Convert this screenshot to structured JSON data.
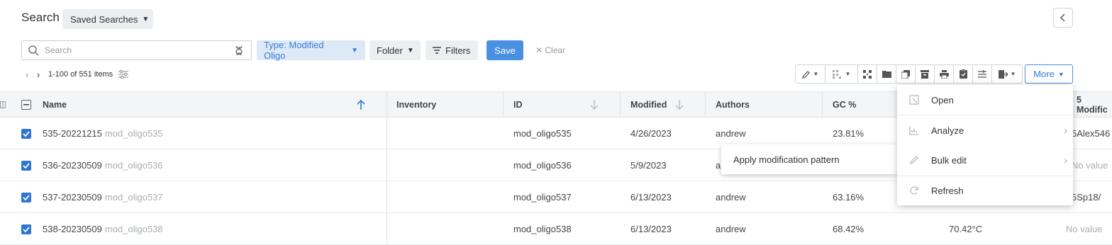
{
  "header": {
    "title": "Search",
    "saved_searches": "Saved Searches"
  },
  "search": {
    "placeholder": "Search",
    "value": ""
  },
  "filters": {
    "type_chip": "Type: Modified Oligo",
    "folder_chip": "Folder",
    "filters_chip": "Filters",
    "save": "Save",
    "clear": "Clear"
  },
  "pager": {
    "count": "1-100 of 551 items"
  },
  "toolbar": {
    "more": "More"
  },
  "table": {
    "columns": [
      "Name",
      "Inventory",
      "ID",
      "Modified",
      "Authors",
      "GC %",
      "5 Modific"
    ],
    "rows": [
      {
        "name": "535-20221215",
        "sub": "mod_oligo535",
        "id": "mod_oligo535",
        "modified": "4/26/2023",
        "author": "andrew",
        "gc": "23.81%",
        "tm": "",
        "mod5": "5Alex546"
      },
      {
        "name": "536-20230509",
        "sub": "mod_oligo536",
        "id": "mod_oligo536",
        "modified": "5/9/2023",
        "author": "a",
        "gc": "",
        "tm": "",
        "mod5": "No value"
      },
      {
        "name": "537-20230509",
        "sub": "mod_oligo537",
        "id": "mod_oligo537",
        "modified": "6/13/2023",
        "author": "andrew",
        "gc": "63.16%",
        "tm": "",
        "mod5": "5Sp18/"
      },
      {
        "name": "538-20230509",
        "sub": "mod_oligo538",
        "id": "mod_oligo538",
        "modified": "6/13/2023",
        "author": "andrew",
        "gc": "68.42%",
        "tm": "70.42°C",
        "mod5": "No value"
      }
    ]
  },
  "submenu": {
    "item": "Apply modification pattern"
  },
  "dropdown": {
    "items": [
      {
        "label": "Open",
        "icon": "open-icon"
      },
      {
        "label": "Analyze",
        "icon": "chart-icon"
      },
      {
        "label": "Bulk edit",
        "icon": "edit-icon"
      },
      {
        "label": "Refresh",
        "icon": "refresh-icon"
      }
    ]
  },
  "colors": {
    "accent": "#4a90e2",
    "checkbox": "#2f75d6",
    "chip_bg": "#dde9f7"
  }
}
